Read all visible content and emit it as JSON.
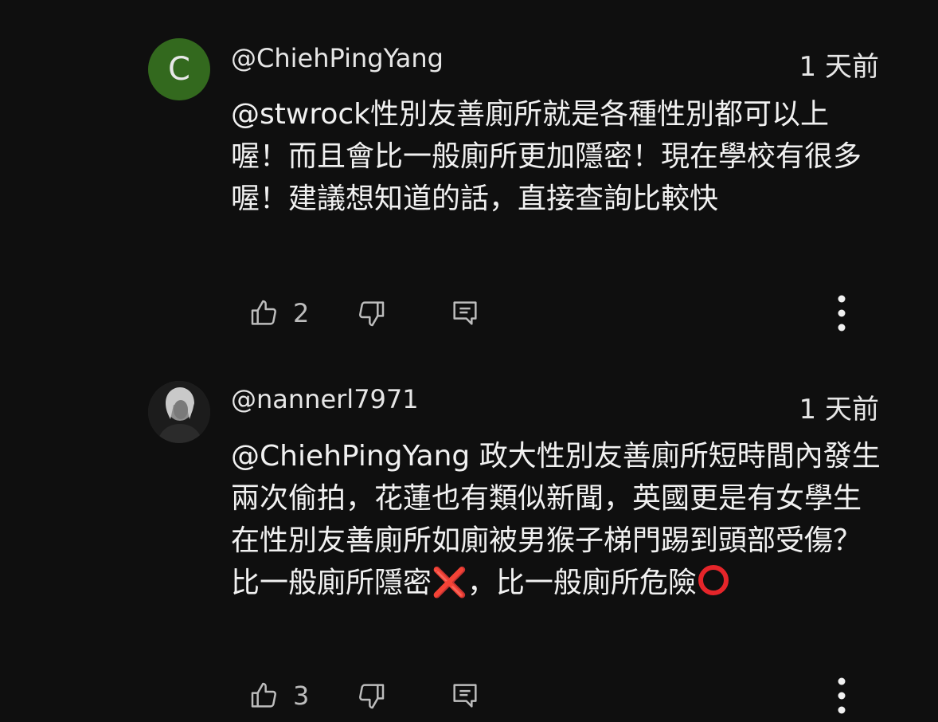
{
  "comments": [
    {
      "author": "@ChiehPingYang",
      "avatar_letter": "C",
      "avatar_color": "#33691e",
      "time": "1 天前",
      "text": "@stwrock性別友善廁所就是各種性別都可以上喔！而且會比一般廁所更加隱密！現在學校有很多喔！建議想知道的話，直接查詢比較快",
      "likes": "2"
    },
    {
      "author": "@nannerl7971",
      "time": "1 天前",
      "text_before_x": "@ChiehPingYang 政大性別友善廁所短時間內發生兩次偷拍，花蓮也有類似新聞，英國更是有女學生在性別友善廁所如廁被男猴子梯門踢到頭部受傷？比一般廁所隱密",
      "x_emoji": "❌",
      "text_after_x": "，比一般廁所危險",
      "o_emoji_name": "heavy-large-circle",
      "likes": "3"
    }
  ],
  "icons": {
    "like": "thumbs-up-icon",
    "dislike": "thumbs-down-icon",
    "reply": "reply-icon",
    "more": "more-vert-icon"
  },
  "colors": {
    "background": "#0f0f0f",
    "text": "#f1f1f1",
    "icon": "#bdbdbd",
    "emoji_red": "#e5252a"
  }
}
